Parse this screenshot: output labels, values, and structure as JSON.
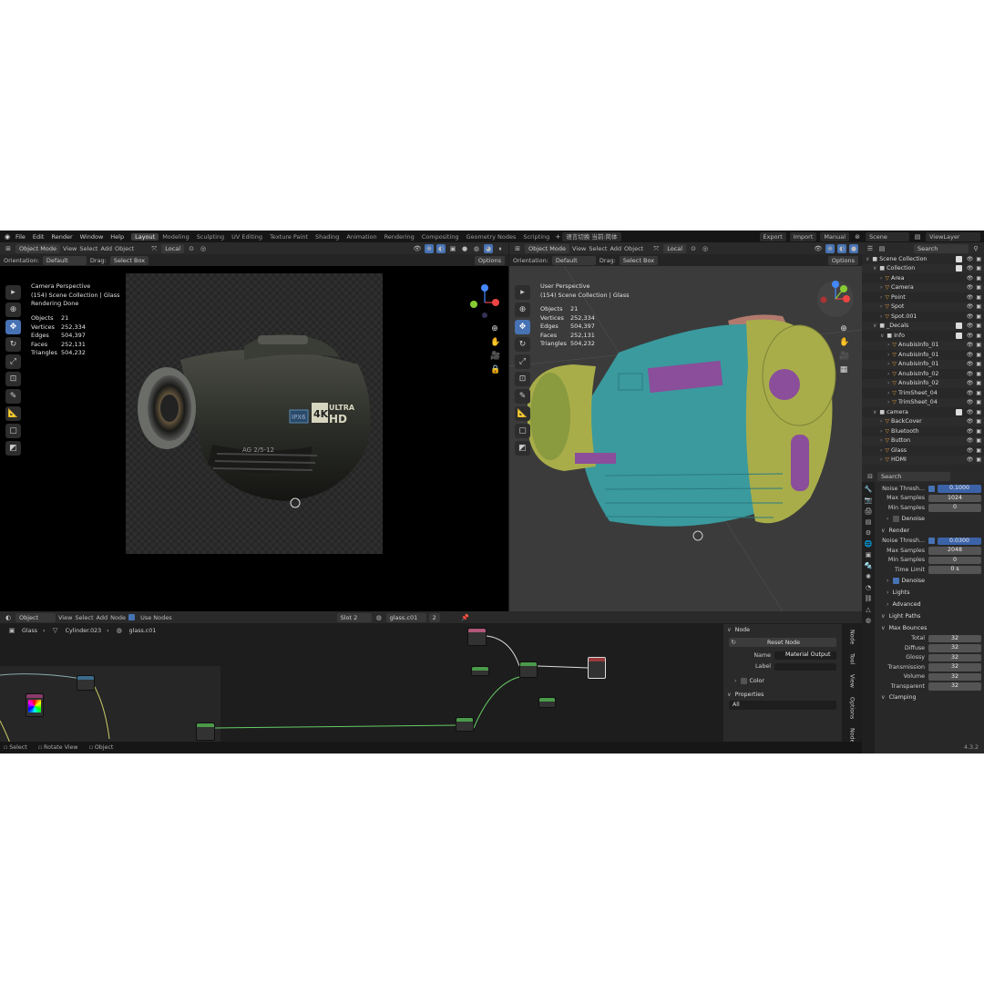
{
  "menu": [
    "File",
    "Edit",
    "Render",
    "Window",
    "Help"
  ],
  "workspaces": [
    "Layout",
    "Modeling",
    "Sculpting",
    "UV Editing",
    "Texture Paint",
    "Shading",
    "Animation",
    "Rendering",
    "Compositing",
    "Geometry Nodes",
    "Scripting"
  ],
  "ws_extra": "语言切换 当前:简体",
  "top_right": {
    "export": "Export",
    "import": "Import",
    "manual": "Manual",
    "scene": "Scene",
    "view_layer": "ViewLayer"
  },
  "left_vp": {
    "mode": "Object Mode",
    "view": "View",
    "select": "Select",
    "add": "Add",
    "object": "Object",
    "transform": "Local",
    "orientation_label": "Orientation:",
    "orientation": "Default",
    "drag_label": "Drag:",
    "drag": "Select Box",
    "options": "Options",
    "title": "Camera Perspective",
    "collection": "(154) Scene Collection | Glass",
    "status": "Rendering Done",
    "stats": [
      [
        "Objects",
        "21"
      ],
      [
        "Vertices",
        "252,334"
      ],
      [
        "Edges",
        "504,397"
      ],
      [
        "Faces",
        "252,131"
      ],
      [
        "Triangles",
        "504,232"
      ]
    ]
  },
  "right_vp": {
    "mode": "Object Mode",
    "view": "View",
    "select": "Select",
    "add": "Add",
    "object": "Object",
    "transform": "Local",
    "orientation_label": "Orientation:",
    "orientation": "Default",
    "drag_label": "Drag:",
    "drag": "Select Box",
    "options": "Options",
    "title": "User Perspective",
    "collection": "(154) Scene Collection | Glass",
    "stats": [
      [
        "Objects",
        "21"
      ],
      [
        "Vertices",
        "252,334"
      ],
      [
        "Edges",
        "504,397"
      ],
      [
        "Faces",
        "252,131"
      ],
      [
        "Triangles",
        "504,232"
      ]
    ]
  },
  "camera_text": {
    "badge1": "IPX6",
    "badge2": "4K",
    "ultra": "ULTRA",
    "hd": "HD",
    "lens_label": "AG 2/5-12"
  },
  "outliner": {
    "search": "Search",
    "rows": [
      {
        "name": "Scene Collection",
        "indent": 0,
        "type": "col"
      },
      {
        "name": "Collection",
        "indent": 1,
        "type": "col"
      },
      {
        "name": "Area",
        "indent": 2,
        "type": "obj"
      },
      {
        "name": "Camera",
        "indent": 2,
        "type": "obj"
      },
      {
        "name": "Point",
        "indent": 2,
        "type": "obj"
      },
      {
        "name": "Spot",
        "indent": 2,
        "type": "obj"
      },
      {
        "name": "Spot.001",
        "indent": 2,
        "type": "obj"
      },
      {
        "name": "_Decals",
        "indent": 1,
        "type": "col"
      },
      {
        "name": "Info",
        "indent": 2,
        "type": "col"
      },
      {
        "name": "AnubisInfo_01",
        "indent": 3,
        "type": "obj"
      },
      {
        "name": "AnubisInfo_01",
        "indent": 3,
        "type": "obj"
      },
      {
        "name": "AnubisInfo_01",
        "indent": 3,
        "type": "obj"
      },
      {
        "name": "AnubisInfo_02",
        "indent": 3,
        "type": "obj"
      },
      {
        "name": "AnubisInfo_02",
        "indent": 3,
        "type": "obj"
      },
      {
        "name": "TrimSheet_04",
        "indent": 3,
        "type": "obj"
      },
      {
        "name": "TrimSheet_04",
        "indent": 3,
        "type": "obj"
      },
      {
        "name": "camera",
        "indent": 1,
        "type": "col"
      },
      {
        "name": "BackCover",
        "indent": 2,
        "type": "obj"
      },
      {
        "name": "Bluetooth",
        "indent": 2,
        "type": "obj"
      },
      {
        "name": "Button",
        "indent": 2,
        "type": "obj"
      },
      {
        "name": "Glass",
        "indent": 2,
        "type": "obj"
      },
      {
        "name": "HDMI",
        "indent": 2,
        "type": "obj"
      }
    ]
  },
  "properties": {
    "search": "Search",
    "rows": [
      {
        "kind": "val",
        "label": "Noise Thresh...",
        "value": "0.1000",
        "check": true
      },
      {
        "kind": "val",
        "label": "Max Samples",
        "value": "1024"
      },
      {
        "kind": "val",
        "label": "Min Samples",
        "value": "0"
      },
      {
        "kind": "sub",
        "label": "Denoise",
        "check": false
      },
      {
        "kind": "sec",
        "label": "Render"
      },
      {
        "kind": "val",
        "label": "Noise Thresh...",
        "value": "0.0300",
        "check": true
      },
      {
        "kind": "val",
        "label": "Max Samples",
        "value": "2048"
      },
      {
        "kind": "val",
        "label": "Min Samples",
        "value": "0"
      },
      {
        "kind": "val",
        "label": "Time Limit",
        "value": "0 s"
      },
      {
        "kind": "sub",
        "label": "Denoise",
        "check": true
      },
      {
        "kind": "sub",
        "label": "Lights"
      },
      {
        "kind": "sub",
        "label": "Advanced"
      },
      {
        "kind": "sec",
        "label": "Light Paths"
      },
      {
        "kind": "sec",
        "label": "Max Bounces"
      },
      {
        "kind": "val",
        "label": "Total",
        "value": "32"
      },
      {
        "kind": "val",
        "label": "Diffuse",
        "value": "32"
      },
      {
        "kind": "val",
        "label": "Glossy",
        "value": "32"
      },
      {
        "kind": "val",
        "label": "Transmission",
        "value": "32"
      },
      {
        "kind": "val",
        "label": "Volume",
        "value": "32"
      },
      {
        "kind": "val",
        "label": "Transparent",
        "value": "32"
      },
      {
        "kind": "sec",
        "label": "Clamping"
      }
    ]
  },
  "node_editor": {
    "mode": "Object",
    "view": "View",
    "select": "Select",
    "add": "Add",
    "node": "Node",
    "use_nodes": "Use Nodes",
    "slot": "Slot 2",
    "material": "glass.c01",
    "users": "2",
    "breadcrumb": [
      "Glass",
      "Cylinder.023",
      "glass.c01"
    ]
  },
  "node_panel": {
    "title": "Node",
    "reset": "Reset Node",
    "name_label": "Name",
    "name_value": "Material Output",
    "label_label": "Label",
    "color": "Color",
    "properties": "Properties",
    "all": "All",
    "tabs": [
      "Node",
      "Tool",
      "View",
      "Options",
      "Node W"
    ]
  },
  "status_bar": {
    "select": "Select",
    "rotate": "Rotate View",
    "object": "Object",
    "version": "4.3.2"
  },
  "colors": {
    "accent": "#4772b3",
    "body_teal": "#3a9a9e",
    "trim_yellow": "#a8ad4a",
    "decal_purple": "#8a4e9a",
    "cap_pink": "#b27a6e"
  }
}
